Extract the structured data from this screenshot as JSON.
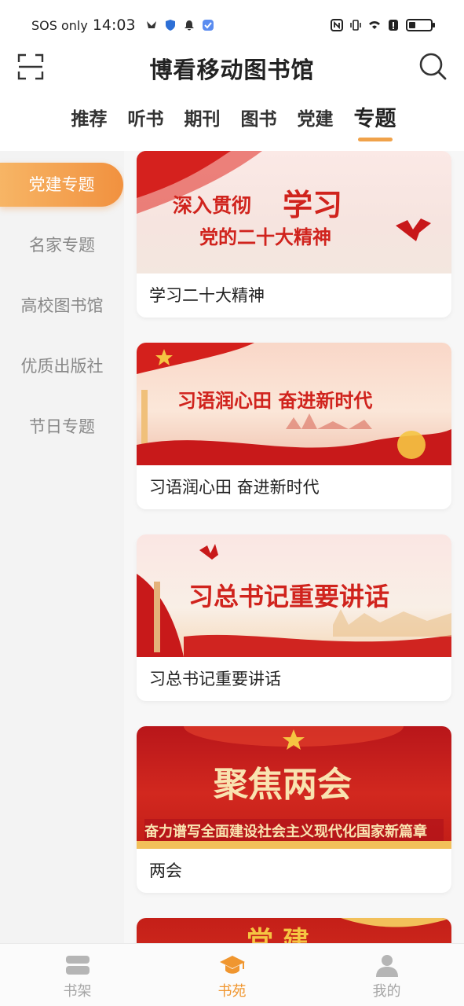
{
  "status_bar": {
    "sos": "SOS only",
    "time": "14:03"
  },
  "header": {
    "title": "博看移动图书馆",
    "scan_icon": "scan-icon",
    "search_icon": "search-icon"
  },
  "tabs": [
    {
      "label": "推荐"
    },
    {
      "label": "听书"
    },
    {
      "label": "期刊"
    },
    {
      "label": "图书"
    },
    {
      "label": "党建"
    },
    {
      "label": "专题"
    }
  ],
  "active_tab": "专题",
  "sidebar": {
    "items": [
      {
        "label": "党建专题"
      },
      {
        "label": "名家专题"
      },
      {
        "label": "高校图书馆"
      },
      {
        "label": "优质出版社"
      },
      {
        "label": "节日专题"
      }
    ]
  },
  "cards": [
    {
      "title": "学习二十大精神",
      "banner_line1": "深入贯彻",
      "banner_big": "学习",
      "banner_line2": "党的二十大精神"
    },
    {
      "title": "习语润心田 奋进新时代",
      "banner_text": "习语润心田  奋进新时代"
    },
    {
      "title": "习总书记重要讲话",
      "banner_text": "习总书记重要讲话"
    },
    {
      "title": "两会",
      "banner_big": "聚焦两会",
      "banner_sub": "奋力谱写全面建设社会主义现代化国家新篇章"
    },
    {
      "banner_partial": "党 建"
    }
  ],
  "bottom_nav": [
    {
      "label": "书架",
      "icon": "bookshelf-icon"
    },
    {
      "label": "书苑",
      "icon": "graduation-cap-icon"
    },
    {
      "label": "我的",
      "icon": "user-icon"
    }
  ],
  "colors": {
    "accent": "#f0962f",
    "accent_light": "#f7b565",
    "party_red": "#d0231d"
  }
}
